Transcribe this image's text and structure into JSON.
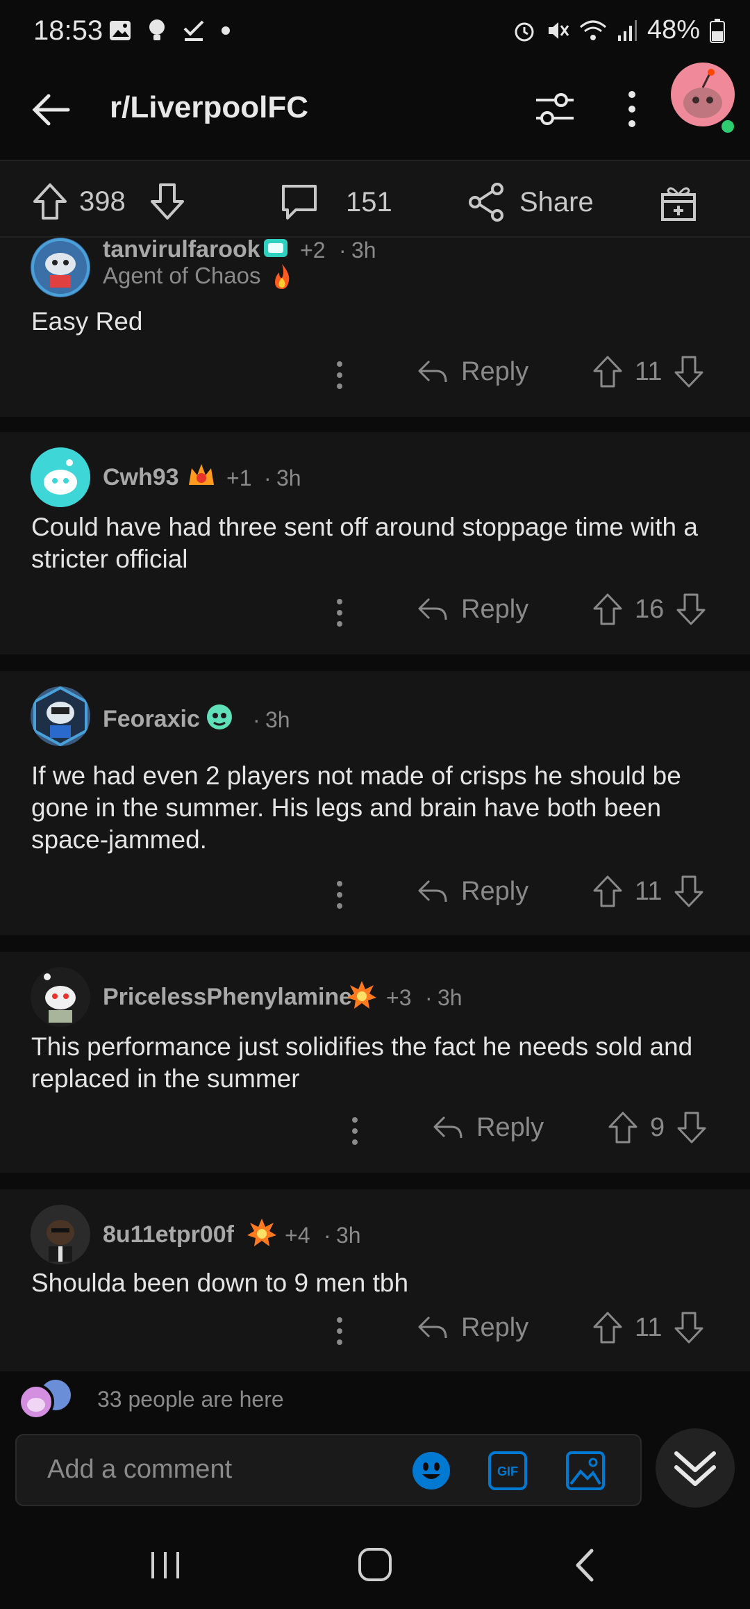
{
  "status": {
    "time": "18:53",
    "battery": "48%",
    "left_icons": [
      "gallery-icon",
      "bulb-icon",
      "check-icon",
      "dot-icon"
    ],
    "right_icons": [
      "alarm-icon",
      "mute-icon",
      "wifi-icon",
      "signal-icon",
      "battery-icon"
    ]
  },
  "header": {
    "subreddit": "r/LiverpoolFC"
  },
  "actions": {
    "score": "398",
    "comments": "151",
    "share_label": "Share"
  },
  "comments": [
    {
      "user": "tanvirulfarook",
      "award_count": "+2",
      "time": "3h",
      "flair": "Agent of Chaos",
      "body": "Easy Red",
      "votes": "11",
      "reply_label": "Reply",
      "avatar_color": "#3a6fa8"
    },
    {
      "user": "Cwh93",
      "award_count": "+1",
      "time": "3h",
      "body": "Could have had three sent off around stoppage time with a stricter official",
      "votes": "16",
      "reply_label": "Reply",
      "avatar_color": "#3fd6d8"
    },
    {
      "user": "Feoraxic",
      "award_count": "",
      "time": "3h",
      "body": "If we had even 2 players not made of crisps he should be gone in the summer. His legs and brain have both been space-jammed.",
      "votes": "11",
      "reply_label": "Reply",
      "avatar_color": "#3a5a80"
    },
    {
      "user": "PricelessPhenylamine",
      "award_count": "+3",
      "time": "3h",
      "body": "This performance just solidifies the fact he needs sold and replaced in the summer",
      "votes": "9",
      "reply_label": "Reply",
      "avatar_color": "#e8e8e8"
    },
    {
      "user": "8u11etpr00f",
      "award_count": "+4",
      "time": "3h",
      "body": "Shoulda been down to 9 men tbh",
      "votes": "11",
      "reply_label": "Reply",
      "avatar_color": "#2b2b2b"
    }
  ],
  "presence": {
    "text": "33 people are here"
  },
  "composer": {
    "placeholder": "Add a comment"
  },
  "colors": {
    "accent": "#0079d3",
    "background": "#0b0b0b",
    "card": "#151515",
    "online": "#2ecc71"
  }
}
